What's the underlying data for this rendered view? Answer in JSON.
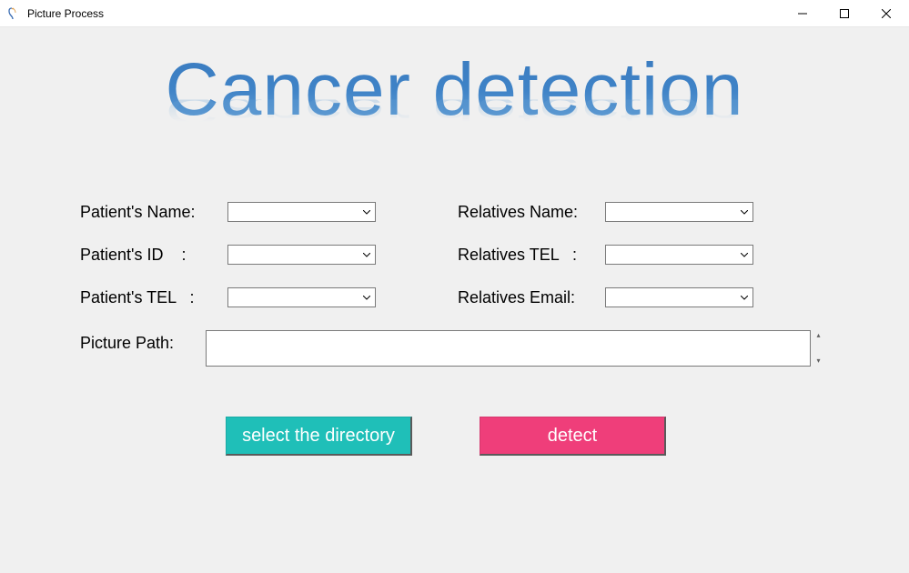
{
  "window": {
    "title": "Picture Process"
  },
  "heading": "Cancer detection",
  "fields": {
    "patient_name": {
      "label": "Patient's Name:",
      "value": ""
    },
    "patient_id": {
      "label": "Patient's ID    :",
      "value": ""
    },
    "patient_tel": {
      "label": "Patient's TEL   :",
      "value": ""
    },
    "rel_name": {
      "label": "Relatives Name:",
      "value": ""
    },
    "rel_tel": {
      "label": "Relatives TEL   :",
      "value": ""
    },
    "rel_email": {
      "label": "Relatives Email:",
      "value": ""
    }
  },
  "picture_path": {
    "label": "Picture Path:",
    "value": ""
  },
  "buttons": {
    "select_dir": "select the directory",
    "detect": "detect"
  },
  "colors": {
    "teal": "#1fbfb8",
    "pink": "#ef3e7a",
    "heading_blue": "#3f83c7"
  }
}
